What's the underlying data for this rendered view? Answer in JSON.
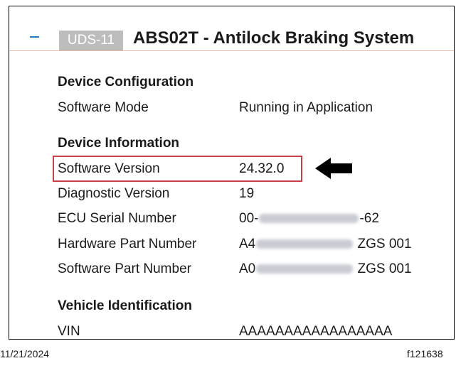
{
  "header": {
    "badge": "UDS-11",
    "title": "ABS02T - Antilock Braking System",
    "collapse_icon": "minus-icon"
  },
  "device_configuration": {
    "heading": "Device Configuration",
    "software_mode_label": "Software Mode",
    "software_mode_value": "Running in Application"
  },
  "device_information": {
    "heading": "Device Information",
    "software_version_label": "Software Version",
    "software_version_value": "24.32.0",
    "diagnostic_version_label": "Diagnostic Version",
    "diagnostic_version_value": "19",
    "ecu_serial_label": "ECU Serial Number",
    "ecu_serial_prefix": "00-",
    "ecu_serial_suffix": "-62",
    "hardware_part_label": "Hardware Part Number",
    "hardware_part_prefix": "A4",
    "hardware_part_suffix": "ZGS 001",
    "software_part_label": "Software Part Number",
    "software_part_prefix": "A0",
    "software_part_suffix": "ZGS 001"
  },
  "vehicle_identification": {
    "heading": "Vehicle Identification",
    "vin_label": "VIN",
    "vin_value": "AAAAAAAAAAAAAAAAA"
  },
  "annotation": {
    "arrow_icon": "left-arrow-icon",
    "highlight_color": "#c84048"
  },
  "footer": {
    "date": "11/21/2024",
    "figure_code": "f121638"
  },
  "colors": {
    "accent_blue": "#2c77c2",
    "badge_bg": "#bdbdbd",
    "header_rule": "#e3b8a5"
  }
}
